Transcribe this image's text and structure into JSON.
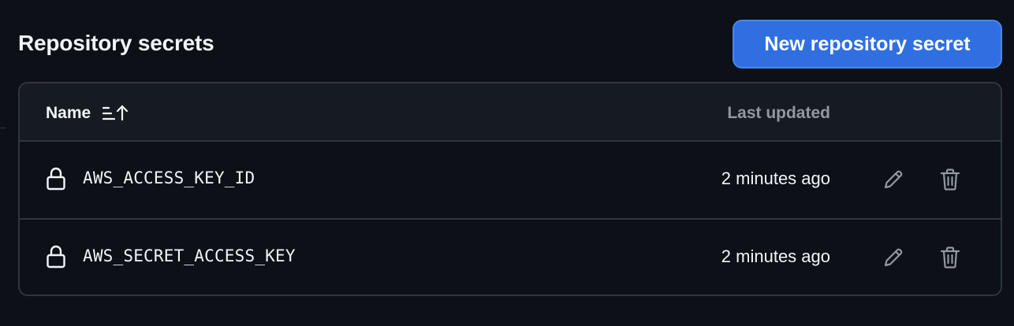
{
  "header": {
    "title": "Repository secrets",
    "new_button_label": "New repository secret"
  },
  "table": {
    "columns": {
      "name": "Name",
      "last_updated": "Last updated"
    },
    "rows": [
      {
        "name": "AWS_ACCESS_KEY_ID",
        "updated": "2 minutes ago"
      },
      {
        "name": "AWS_SECRET_ACCESS_KEY",
        "updated": "2 minutes ago"
      }
    ]
  },
  "icons": {
    "sort": "sort-ascending-icon",
    "lock": "lock-icon",
    "edit": "pencil-icon",
    "delete": "trash-icon"
  },
  "colors": {
    "background": "#0d1117",
    "header_bg": "#161b22",
    "border": "#30363d",
    "primary_button": "#2f6fe0",
    "muted_text": "#9198a1"
  }
}
